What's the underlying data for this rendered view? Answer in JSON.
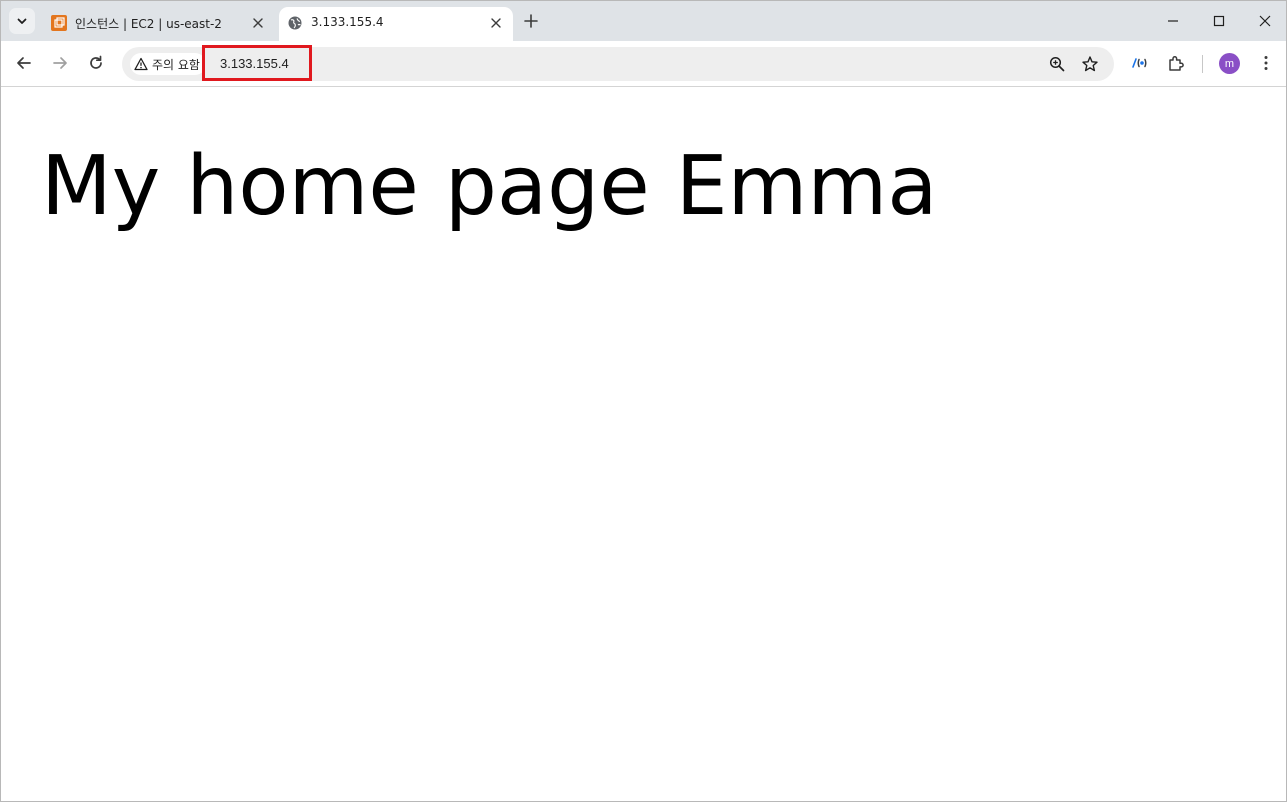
{
  "browser": {
    "tabs": [
      {
        "title": "인스턴스 | EC2 | us-east-2",
        "favicon": "aws-ec2-icon",
        "active": false
      },
      {
        "title": "3.133.155.4",
        "favicon": "globe-icon",
        "active": true
      }
    ],
    "address_bar": {
      "security_label": "주의 요함",
      "url": "3.133.155.4"
    },
    "profile_initial": "m",
    "colors": {
      "tabstrip_bg": "#dfe3e7",
      "highlight_box": "#e0181e",
      "avatar_bg": "#8a4fc6"
    }
  },
  "page": {
    "heading": "My home page Emma"
  }
}
